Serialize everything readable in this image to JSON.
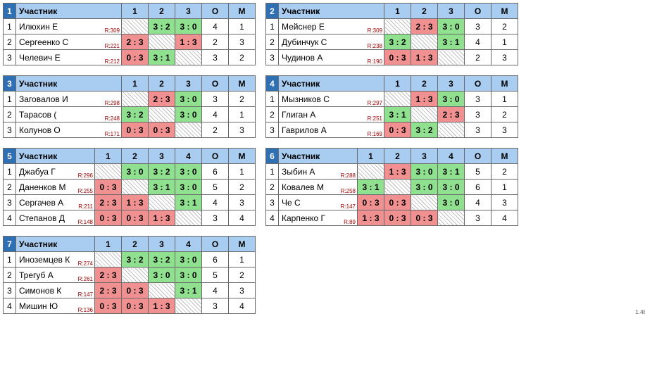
{
  "labels": {
    "participant": "Участник",
    "O": "О",
    "M": "М",
    "ratingPrefix": "R:"
  },
  "footer": "1.48",
  "groups": [
    {
      "n": 1,
      "cols": 3,
      "nameW": 150,
      "rows": [
        {
          "name": "Илюхин Е",
          "r": 309,
          "cells": [
            "",
            "3 : 2",
            "3 : 0"
          ],
          "o": 4,
          "m": 1
        },
        {
          "name": "Сергеенко С",
          "r": 221,
          "cells": [
            "2 : 3",
            "",
            "1 : 3"
          ],
          "o": 2,
          "m": 3
        },
        {
          "name": "Челевич Е",
          "r": 212,
          "cells": [
            "0 : 3",
            "3 : 1",
            ""
          ],
          "o": 3,
          "m": 2
        }
      ]
    },
    {
      "n": 2,
      "cols": 3,
      "nameW": 150,
      "rows": [
        {
          "name": "Мейснер Е",
          "r": 309,
          "cells": [
            "",
            "2 : 3",
            "3 : 0"
          ],
          "o": 3,
          "m": 2
        },
        {
          "name": "Дубинчук С",
          "r": 238,
          "cells": [
            "3 : 2",
            "",
            "3 : 1"
          ],
          "o": 4,
          "m": 1
        },
        {
          "name": "Чудинов А",
          "r": 190,
          "cells": [
            "0 : 3",
            "1 : 3",
            ""
          ],
          "o": 2,
          "m": 3
        }
      ]
    },
    {
      "n": 3,
      "cols": 3,
      "nameW": 150,
      "rows": [
        {
          "name": "Заговалов И",
          "r": 298,
          "cells": [
            "",
            "2 : 3",
            "3 : 0"
          ],
          "o": 3,
          "m": 2
        },
        {
          "name": "Тарасов (",
          "r": 248,
          "cells": [
            "3 : 2",
            "",
            "3 : 0"
          ],
          "o": 4,
          "m": 1
        },
        {
          "name": "Колунов О",
          "r": 171,
          "cells": [
            "0 : 3",
            "0 : 3",
            ""
          ],
          "o": 2,
          "m": 3
        }
      ]
    },
    {
      "n": 4,
      "cols": 3,
      "nameW": 150,
      "rows": [
        {
          "name": "Мызников С",
          "r": 297,
          "cells": [
            "",
            "1 : 3",
            "3 : 0"
          ],
          "o": 3,
          "m": 1
        },
        {
          "name": "Глиган А",
          "r": 251,
          "cells": [
            "3 : 1",
            "",
            "2 : 3"
          ],
          "o": 3,
          "m": 2
        },
        {
          "name": "Гаврилов А",
          "r": 169,
          "cells": [
            "0 : 3",
            "3 : 2",
            ""
          ],
          "o": 3,
          "m": 3
        }
      ]
    },
    {
      "n": 5,
      "cols": 4,
      "nameW": 112,
      "rows": [
        {
          "name": "Джабуа Г",
          "r": 296,
          "cells": [
            "",
            "3 : 0",
            "3 : 2",
            "3 : 0"
          ],
          "o": 6,
          "m": 1
        },
        {
          "name": "Даненков М",
          "r": 255,
          "cells": [
            "0 : 3",
            "",
            "3 : 1",
            "3 : 0"
          ],
          "o": 5,
          "m": 2
        },
        {
          "name": "Сергачев А",
          "r": 211,
          "cells": [
            "2 : 3",
            "1 : 3",
            "",
            "3 : 1"
          ],
          "o": 4,
          "m": 3
        },
        {
          "name": "Степанов Д",
          "r": 148,
          "cells": [
            "0 : 3",
            "0 : 3",
            "1 : 3",
            ""
          ],
          "o": 3,
          "m": 4
        }
      ]
    },
    {
      "n": 6,
      "cols": 4,
      "nameW": 112,
      "rows": [
        {
          "name": "Зыбин А",
          "r": 288,
          "cells": [
            "",
            "1 : 3",
            "3 : 0",
            "3 : 1"
          ],
          "o": 5,
          "m": 2
        },
        {
          "name": "Ковалев М",
          "r": 258,
          "cells": [
            "3 : 1",
            "",
            "3 : 0",
            "3 : 0"
          ],
          "o": 6,
          "m": 1
        },
        {
          "name": "Че С",
          "r": 147,
          "cells": [
            "0 : 3",
            "0 : 3",
            "",
            "3 : 0"
          ],
          "o": 4,
          "m": 3
        },
        {
          "name": "Карпенко Г",
          "r": 89,
          "cells": [
            "1 : 3",
            "0 : 3",
            "0 : 3",
            ""
          ],
          "o": 3,
          "m": 4
        }
      ]
    },
    {
      "n": 7,
      "cols": 4,
      "nameW": 112,
      "rows": [
        {
          "name": "Иноземцев К",
          "r": 274,
          "cells": [
            "",
            "3 : 2",
            "3 : 2",
            "3 : 0"
          ],
          "o": 6,
          "m": 1
        },
        {
          "name": "Трегуб А",
          "r": 261,
          "cells": [
            "2 : 3",
            "",
            "3 : 0",
            "3 : 0"
          ],
          "o": 5,
          "m": 2
        },
        {
          "name": "Симонов К",
          "r": 147,
          "cells": [
            "2 : 3",
            "0 : 3",
            "",
            "3 : 1"
          ],
          "o": 4,
          "m": 3
        },
        {
          "name": "Мишин Ю",
          "r": 136,
          "cells": [
            "0 : 3",
            "0 : 3",
            "1 : 3",
            ""
          ],
          "o": 3,
          "m": 4
        }
      ]
    }
  ]
}
